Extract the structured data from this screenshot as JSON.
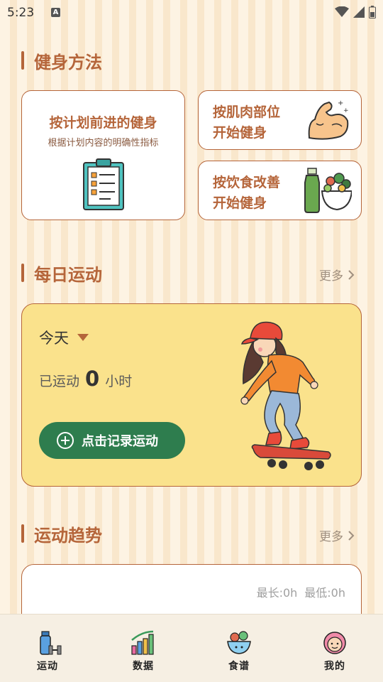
{
  "status_bar": {
    "time": "5:23",
    "notification_letter": "A"
  },
  "fitness_methods": {
    "title": "健身方法",
    "plan_card": {
      "title": "按计划前进的健身",
      "subtitle": "根据计划内容的明确性指标"
    },
    "muscle_card": {
      "line1": "按肌肉部位",
      "line2": "开始健身"
    },
    "diet_card": {
      "line1": "按饮食改善",
      "line2": "开始健身"
    }
  },
  "daily_exercise": {
    "title": "每日运动",
    "more": "更多",
    "day_select": "今天",
    "exercised_prefix": "已运动",
    "hours": "0",
    "unit": "小时",
    "record_button": "点击记录运动"
  },
  "trend": {
    "title": "运动趋势",
    "more": "更多",
    "max_label": "最长:0h",
    "min_label": "最低:0h"
  },
  "tab_bar": {
    "tabs": [
      {
        "label": "运动",
        "icon": "dumbbell-bottle-icon"
      },
      {
        "label": "数据",
        "icon": "bar-chart-icon"
      },
      {
        "label": "食谱",
        "icon": "food-bowl-icon"
      },
      {
        "label": "我的",
        "icon": "girl-avatar-icon"
      }
    ]
  },
  "colors": {
    "accent": "#b5653a",
    "primary_button": "#2e7d4e",
    "daily_card_bg": "#fae28c",
    "background": "#fdf3e3"
  }
}
